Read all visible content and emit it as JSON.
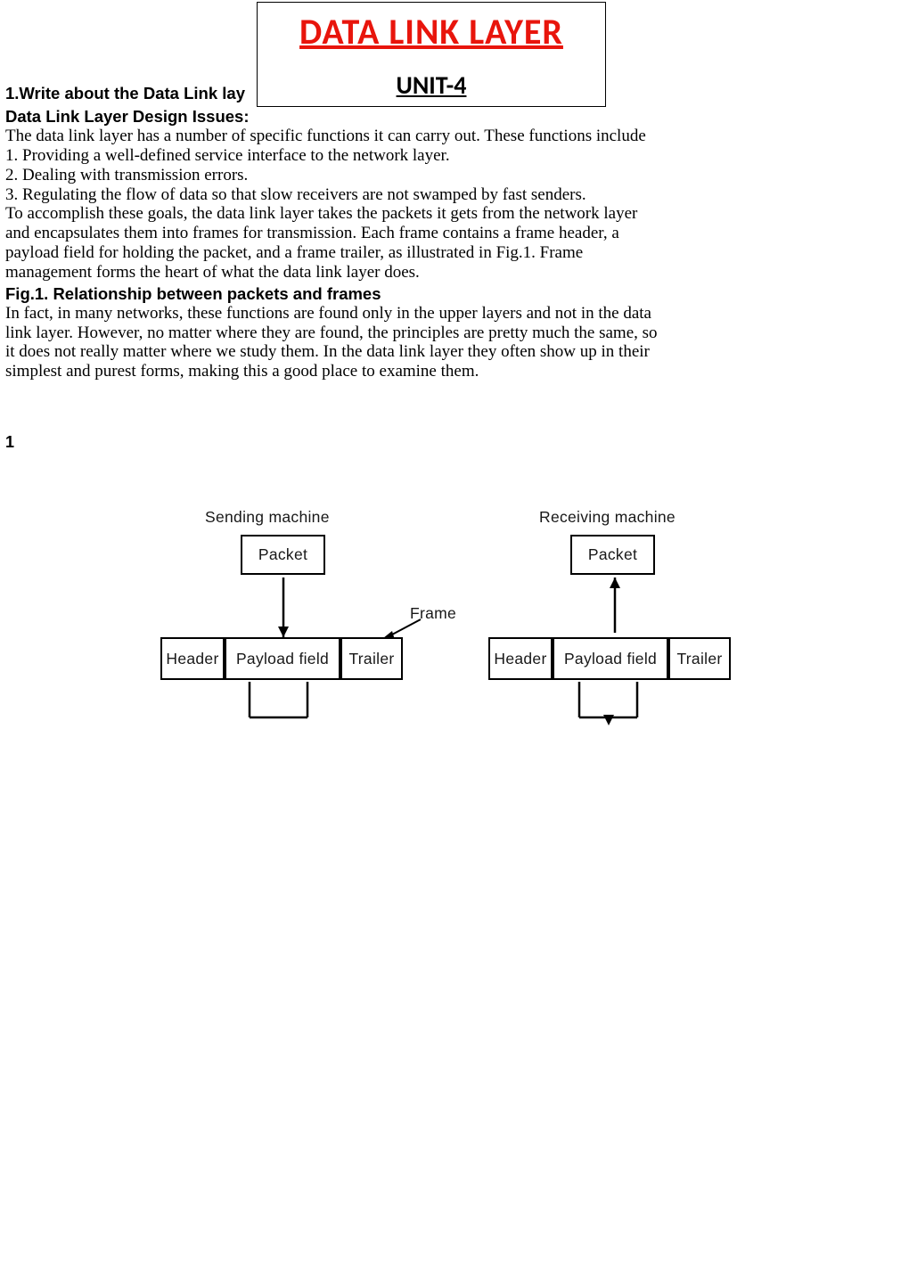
{
  "titleBox": {
    "mainTitle": "DATA LINK LAYER",
    "unit": "UNIT-4"
  },
  "q1_heading": "1.Write about the Data Link lay",
  "section1_heading": "Data Link Layer Design Issues:",
  "para1_l1": "The data link layer has a number of specific functions it can carry out. These functions include",
  "para1_l2": "1. Providing a well-defined service interface to the network layer.",
  "para1_l3": "2. Dealing with transmission errors.",
  "para1_l4": "3. Regulating the flow of data so that slow receivers are not swamped by fast senders.",
  "para1_l5": "To accomplish these goals, the data link layer takes the packets it gets from the network layer",
  "para1_l6": "and encapsulates them into frames for transmission. Each frame contains a frame header, a",
  "para1_l7": "payload field for holding the packet, and a frame trailer, as illustrated in Fig.1. Frame",
  "para1_l8": "management forms the heart of what the data link layer does.",
  "fig1_heading": "Fig.1. Relationship between packets and frames",
  "para2_l1": "In fact, in many networks, these functions are found only in the upper layers and not in the data",
  "para2_l2": "link layer. However, no matter where they are found, the principles are pretty much the same, so",
  "para2_l3": "it does not really matter where we study them. In the data link layer they often show up in their",
  "para2_l4": "simplest and purest forms, making this a good place to examine them.",
  "page_num": "1",
  "diagram": {
    "sending": "Sending machine",
    "receiving": "Receiving machine",
    "packet": "Packet",
    "frame": "Frame",
    "header": "Header",
    "payload": "Payload field",
    "trailer": "Trailer"
  }
}
